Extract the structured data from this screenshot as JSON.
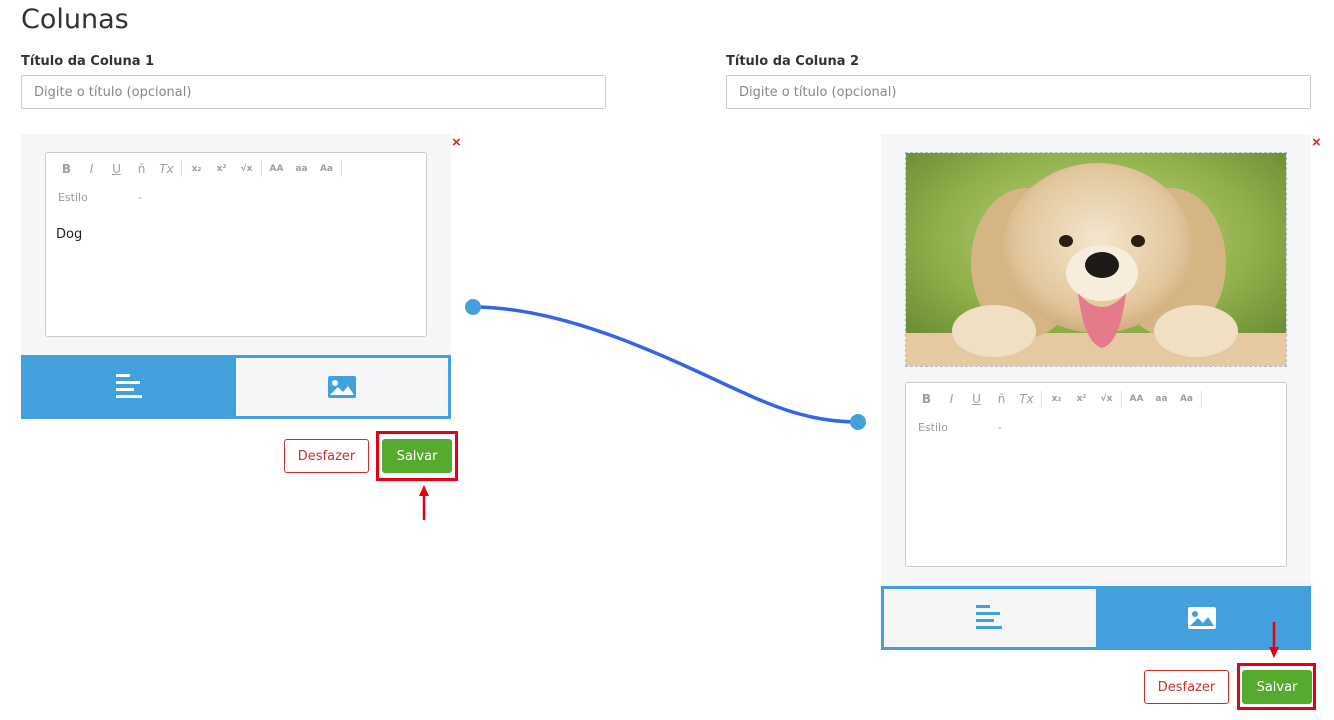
{
  "page": {
    "title": "Colunas"
  },
  "column1": {
    "label": "Título da Coluna 1",
    "placeholder": "Digite o título (opcional)",
    "close_symbol": "×",
    "style_label": "Estilo",
    "style_value": "-",
    "content_text": "Dog",
    "active_tab": "text",
    "undo_label": "Desfazer",
    "save_label": "Salvar"
  },
  "column2": {
    "label": "Título da Coluna 2",
    "placeholder": "Digite o título (opcional)",
    "close_symbol": "×",
    "style_label": "Estilo",
    "style_value": "-",
    "image_subject": "golden-retriever-puppy",
    "active_tab": "image",
    "undo_label": "Desfazer",
    "save_label": "Salvar"
  },
  "toolbar": {
    "bold": "B",
    "italic": "I",
    "underline": "U",
    "overline": "n̄",
    "clear_format": "Tx",
    "subscript": "x₂",
    "superscript": "x²",
    "formula": "√x",
    "uppercase": "AA",
    "lowercase": "aa",
    "capitalize": "Aa"
  },
  "colors": {
    "accent_blue": "#42a0dc",
    "save_green": "#56ab2f",
    "undo_red": "#c9302c",
    "annotation_red": "#e60012",
    "connector_blue": "#3366e6"
  },
  "icons": {
    "text_tab": "align-left-icon",
    "image_tab": "image-icon",
    "close": "close-icon",
    "annotation_arrow": "arrow-icon"
  }
}
